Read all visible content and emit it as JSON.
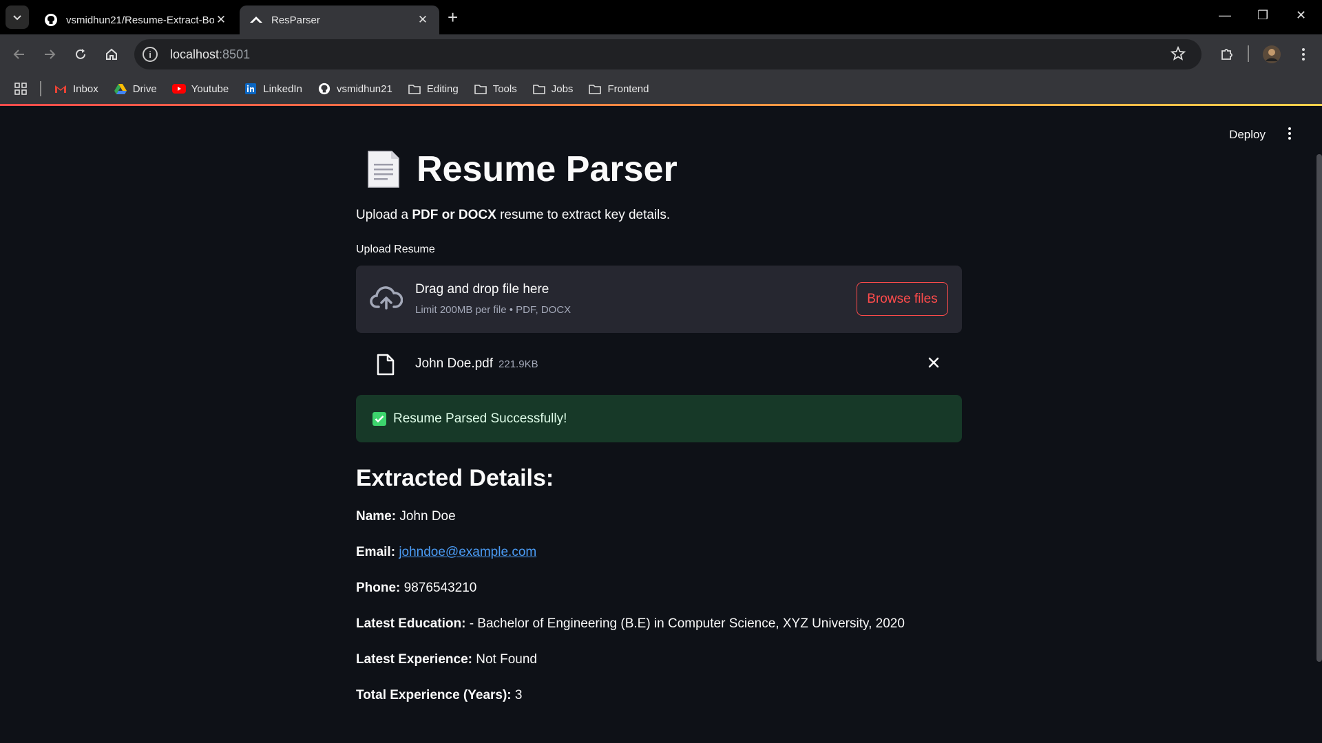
{
  "browser": {
    "tabs": [
      {
        "title": "vsmidhun21/Resume-Extract-Bo",
        "icon": "github-icon"
      },
      {
        "title": "ResParser",
        "icon": "streamlit-icon"
      }
    ],
    "address": {
      "host": "localhost",
      "port": ":8501"
    },
    "bookmarks": [
      {
        "label": "Inbox",
        "icon": "gmail-icon"
      },
      {
        "label": "Drive",
        "icon": "drive-icon"
      },
      {
        "label": "Youtube",
        "icon": "youtube-icon"
      },
      {
        "label": "LinkedIn",
        "icon": "linkedin-icon"
      },
      {
        "label": "vsmidhun21",
        "icon": "github-icon"
      },
      {
        "label": "Editing",
        "icon": "folder-icon"
      },
      {
        "label": "Tools",
        "icon": "folder-icon"
      },
      {
        "label": "Jobs",
        "icon": "folder-icon"
      },
      {
        "label": "Frontend",
        "icon": "folder-icon"
      }
    ]
  },
  "app": {
    "deploy_label": "Deploy",
    "title": "Resume Parser",
    "subtitle": {
      "pre": "Upload a ",
      "bold": "PDF or DOCX",
      "post": " resume to extract key details."
    },
    "upload": {
      "label": "Upload Resume",
      "drag_text": "Drag and drop file here",
      "limit_text": "Limit 200MB per file • PDF, DOCX",
      "browse_label": "Browse files"
    },
    "file": {
      "name": "John Doe.pdf",
      "size": "221.9KB"
    },
    "success_text": "Resume Parsed Successfully!",
    "details_heading": "Extracted Details:",
    "details": {
      "name": {
        "label": "Name:",
        "value": "John Doe"
      },
      "email": {
        "label": "Email:",
        "value": "johndoe@example.com"
      },
      "phone": {
        "label": "Phone:",
        "value": "9876543210"
      },
      "education": {
        "label": "Latest Education:",
        "value": "- Bachelor of Engineering (B.E) in Computer Science, XYZ University, 2020"
      },
      "experience": {
        "label": "Latest Experience:",
        "value": "Not Found"
      },
      "total": {
        "label": "Total Experience (Years):",
        "value": "3"
      }
    }
  },
  "colors": {
    "accent": "#ff4b4b",
    "success_bg": "#173928",
    "link": "#4b9cf5",
    "background": "#0e1117"
  }
}
